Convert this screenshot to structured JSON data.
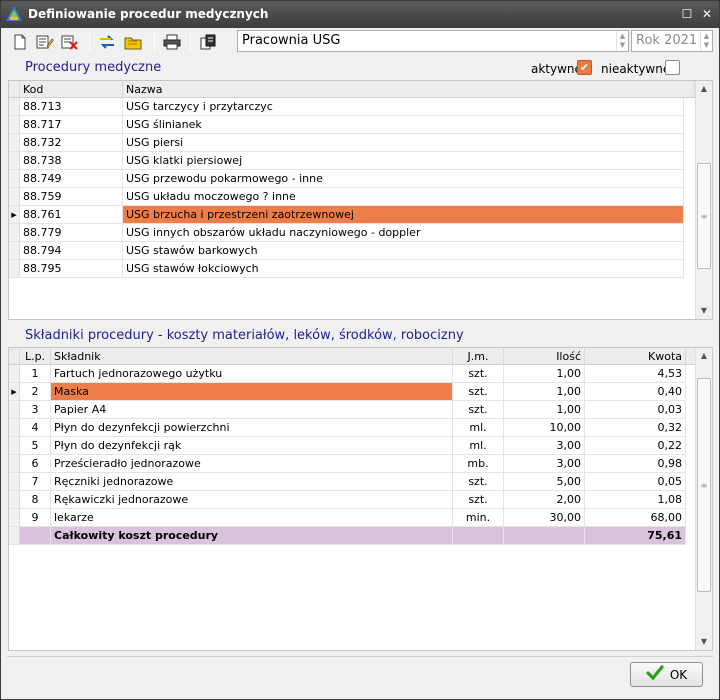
{
  "window": {
    "title": "Definiowanie procedur medycznych"
  },
  "toolbar": {
    "icons": [
      "new-document-icon",
      "edit-icon",
      "delete-icon",
      "swap-icon",
      "folder-icon",
      "print-icon",
      "copy-icon"
    ],
    "department": "Pracownia USG",
    "year": "Rok 2021"
  },
  "procedures": {
    "section_title": "Procedury medyczne",
    "filter_active_label": "aktywne",
    "filter_active_checked": true,
    "filter_inactive_label": "nieaktywne",
    "filter_inactive_checked": false,
    "columns": [
      "Kod",
      "Nazwa"
    ],
    "rows": [
      {
        "code": "88.713",
        "name": "USG tarczycy i przytarczyc"
      },
      {
        "code": "88.717",
        "name": "USG ślinianek"
      },
      {
        "code": "88.732",
        "name": "USG piersi"
      },
      {
        "code": "88.738",
        "name": "USG klatki piersiowej"
      },
      {
        "code": "88.749",
        "name": "USG przewodu pokarmowego - inne"
      },
      {
        "code": "88.759",
        "name": "USG układu moczowego ? inne"
      },
      {
        "code": "88.761",
        "name": "USG brzucha i przestrzeni zaotrzewnowej",
        "selected": true
      },
      {
        "code": "88.779",
        "name": "USG innych obszarów układu naczyniowego - doppler"
      },
      {
        "code": "88.794",
        "name": "USG stawów barkowych"
      },
      {
        "code": "88.795",
        "name": "USG stawów łokciowych"
      }
    ]
  },
  "components": {
    "section_title": "Składniki procedury - koszty materiałów, leków, środków, robocizny",
    "columns": [
      "L.p.",
      "Składnik",
      "J.m.",
      "Ilość",
      "Kwota"
    ],
    "rows": [
      {
        "lp": "1",
        "name": "Fartuch jednorazowego użytku",
        "unit": "szt.",
        "qty": "1,00",
        "amount": "4,53"
      },
      {
        "lp": "2",
        "name": "Maska",
        "unit": "szt.",
        "qty": "1,00",
        "amount": "0,40",
        "selected": true
      },
      {
        "lp": "3",
        "name": "Papier A4",
        "unit": "szt.",
        "qty": "1,00",
        "amount": "0,03"
      },
      {
        "lp": "4",
        "name": "Płyn do dezynfekcji powierzchni",
        "unit": "ml.",
        "qty": "10,00",
        "amount": "0,32"
      },
      {
        "lp": "5",
        "name": "Płyn do dezynfekcji rąk",
        "unit": "ml.",
        "qty": "3,00",
        "amount": "0,22"
      },
      {
        "lp": "6",
        "name": "Prześcieradło jednorazowe",
        "unit": "mb.",
        "qty": "3,00",
        "amount": "0,98"
      },
      {
        "lp": "7",
        "name": "Ręczniki jednorazowe",
        "unit": "szt.",
        "qty": "5,00",
        "amount": "0,05"
      },
      {
        "lp": "8",
        "name": "Rękawiczki jednorazowe",
        "unit": "szt.",
        "qty": "2,00",
        "amount": "1,08"
      },
      {
        "lp": "9",
        "name": "lekarze",
        "unit": "min.",
        "qty": "30,00",
        "amount": "68,00"
      }
    ],
    "total_label": "Całkowity koszt procedury",
    "total_amount": "75,61"
  },
  "footer": {
    "ok_label": "OK"
  },
  "colors": {
    "selection": "#ef7d4a",
    "total_row": "#d9c3dc",
    "section_title": "#1f1f8f"
  }
}
